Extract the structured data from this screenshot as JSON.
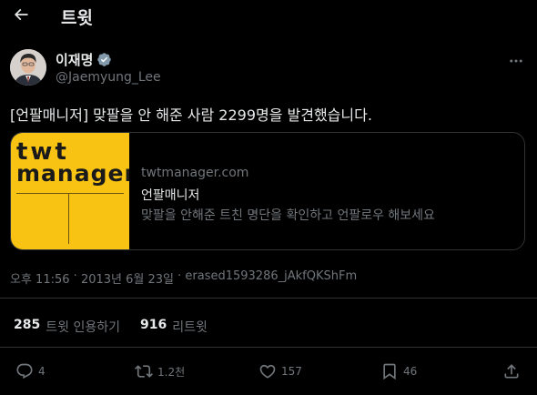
{
  "header": {
    "title": "트윗"
  },
  "author": {
    "name": "이재명",
    "handle": "@Jaemyung_Lee"
  },
  "tweet": {
    "text": "[언팔매니저] 맞팔을 안 해준 사람 2299명을 발견했습니다."
  },
  "card": {
    "logo_line1": "twt",
    "logo_line2": "manager",
    "domain": "twtmanager.com",
    "title": "언팔매니저",
    "description": "맞팔을 안해준 트친 명단을 확인하고 언팔로우 해보세요"
  },
  "meta": {
    "time": "오후 11:56",
    "separator1": " · ",
    "date": "2013년 6월 23일",
    "separator2": " · ",
    "source": "erased1593286_jAkfQKShFm"
  },
  "stats": {
    "quotes_count": "285",
    "quotes_label": "트윗 인용하기",
    "retweets_count": "916",
    "retweets_label": "리트윗"
  },
  "actions": {
    "reply_count": "4",
    "retweet_count": "1.2천",
    "like_count": "157",
    "bookmark_count": "46"
  },
  "colors": {
    "background": "#000000",
    "text": "#e7e9ea",
    "muted": "#71767b",
    "border": "#2f3336",
    "verified": "#829aab",
    "card_logo_bg": "#f8c312"
  }
}
